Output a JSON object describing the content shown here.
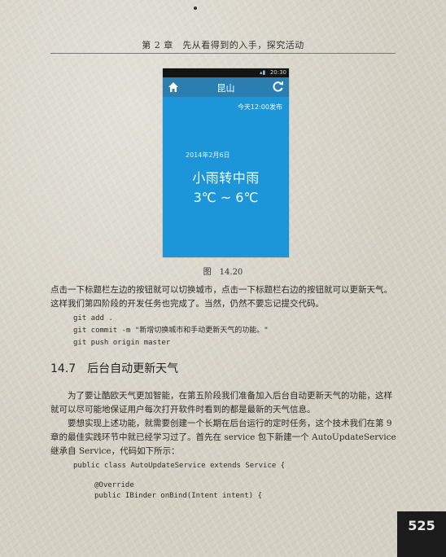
{
  "running_head": "第 2 章　先从看得到的入手，探究活动",
  "phone": {
    "status_time": "20:30",
    "city": "昆山",
    "publish_time": "今天12:00发布",
    "date": "2014年2月6日",
    "weather": "小雨转中雨",
    "temperature": "3℃ ~ 6℃",
    "accent_color": "#1c96d8",
    "icons": [
      "home-icon",
      "refresh-icon"
    ]
  },
  "caption": "图　14.20",
  "paragraph1": "点击一下标题栏左边的按钮就可以切换城市，点击一下标题栏右边的按钮就可以更新天气。这样我们第四阶段的开发任务也完成了。当然，仍然不要忘记提交代码。",
  "code1": [
    "git add .",
    "git commit -m \"新增切换城市和手动更新天气的功能。\"",
    "git push origin master"
  ],
  "section": {
    "number": "14.7",
    "title": "后台自动更新天气"
  },
  "paragraph2": "为了要让酷欧天气更加智能，在第五阶段我们准备加入后台自动更新天气的功能，这样就可以尽可能地保证用户每次打开软件时看到的都是最新的天气信息。",
  "paragraph3": "要想实现上述功能，就需要创建一个长期在后台运行的定时任务，这个技术我们在第 9 章的最佳实践环节中就已经学习过了。首先在 service 包下新建一个 AutoUpdateService 继承自 Service，代码如下所示：",
  "code2": [
    "public class AutoUpdateService extends Service {",
    "@Override",
    "public IBinder onBind(Intent intent) {"
  ],
  "page_number": "525"
}
